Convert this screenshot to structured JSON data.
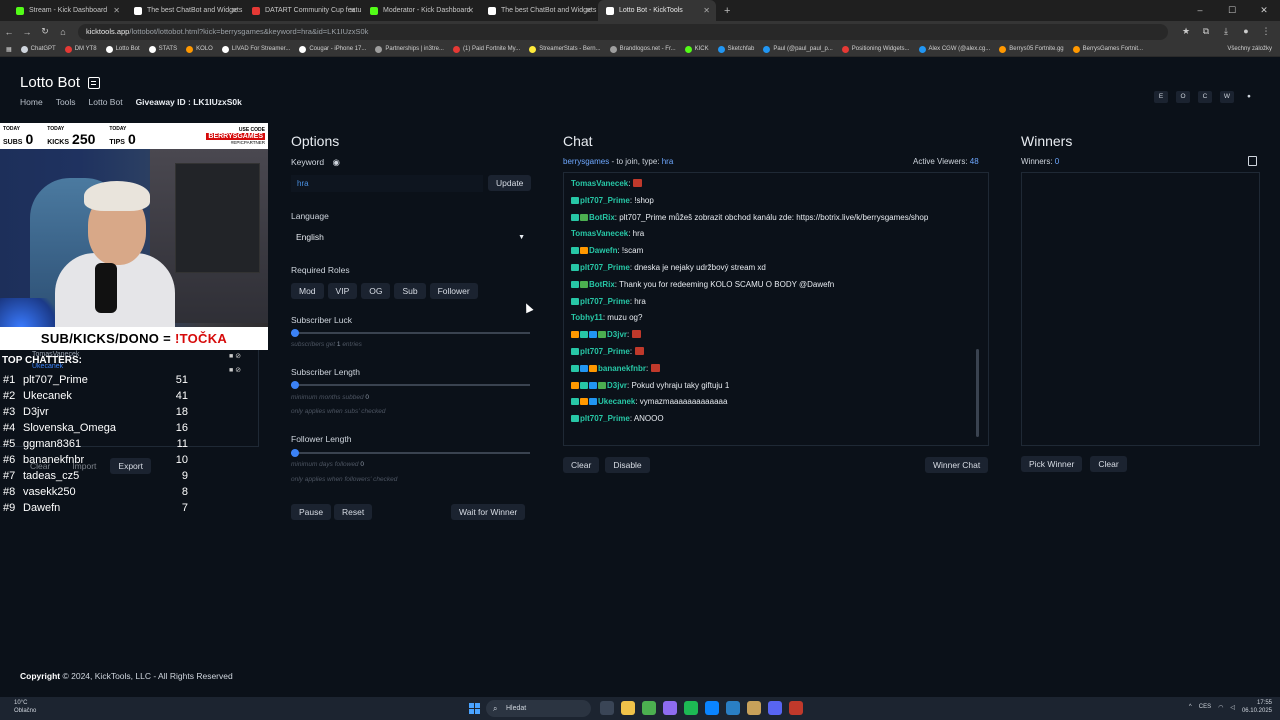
{
  "browser": {
    "tabs": [
      {
        "title": "Stream - Kick Dashboard",
        "color": "#53fc18",
        "active": false
      },
      {
        "title": "The best ChatBot and Widgets",
        "color": "#ffffff",
        "active": false
      },
      {
        "title": "DATART Community Cup featu",
        "color": "#e53935",
        "active": false
      },
      {
        "title": "Moderator - Kick Dashboard",
        "color": "#53fc18",
        "active": false
      },
      {
        "title": "The best ChatBot and Widgets",
        "color": "#ffffff",
        "active": false
      },
      {
        "title": "Lotto Bot - KickTools",
        "color": "#ffffff",
        "active": true
      }
    ],
    "url_host": "kicktools.app",
    "url_path": "/lottobot/lottobot.html?kick=berrysgames&keyword=hra&id=LK1IUzxS0k",
    "bookmarks": [
      {
        "label": "ChatGPT",
        "color": "#cfd5dd"
      },
      {
        "label": "DM YT8",
        "color": "#e53935"
      },
      {
        "label": "Lotto Bot",
        "color": "#ffffff"
      },
      {
        "label": "STATS",
        "color": "#ffffff"
      },
      {
        "label": "KOLO",
        "color": "#ff9800"
      },
      {
        "label": "LIVAD For Streamer...",
        "color": "#ffffff"
      },
      {
        "label": "Cougar - iPhone 17...",
        "color": "#ffffff"
      },
      {
        "label": "Partnerships | in3tre...",
        "color": "#9e9e9e"
      },
      {
        "label": "(1) Paid Fortnite My...",
        "color": "#e53935"
      },
      {
        "label": "StreamerStats - Bern...",
        "color": "#ffeb3b"
      },
      {
        "label": "Brandlogos.net - Fr...",
        "color": "#9e9e9e"
      },
      {
        "label": "KICK",
        "color": "#53fc18"
      },
      {
        "label": "Sketchfab",
        "color": "#2196f3"
      },
      {
        "label": "Paul (@paul_paul_p...",
        "color": "#2196f3"
      },
      {
        "label": "Positioning Widgets...",
        "color": "#e53935"
      },
      {
        "label": "Alex CGW (@alex.cg...",
        "color": "#2196f3"
      },
      {
        "label": "Berrys05 Fortnite.gg",
        "color": "#ff9800"
      },
      {
        "label": "BerrysGames Fortnit...",
        "color": "#ff9800"
      }
    ],
    "bookmarks_more": "Všechny záložky"
  },
  "page": {
    "title": "Lotto Bot",
    "breadcrumb": [
      "Home",
      "Tools",
      "Lotto Bot"
    ],
    "giveaway_id": "Giveaway ID : LK1IUzxS0k",
    "theme_buttons": [
      "E",
      "O",
      "C",
      "W"
    ]
  },
  "stream": {
    "stats": [
      {
        "today": "TODAY",
        "label": "SUBS",
        "value": "0"
      },
      {
        "today": "TODAY",
        "label": "KICKS",
        "value": "250"
      },
      {
        "today": "TODAY",
        "label": "TIPS",
        "value": "0"
      }
    ],
    "use_code": "USE CODE",
    "code": "BERRYSGAMES",
    "code_sub": "#EPICPARTNER",
    "banner_prefix": "SUB/KICKS/DONO = ",
    "banner_highlight": "!TOČKA",
    "top_chatters_title": "TOP CHATTERS:",
    "ghost_names": [
      "TomasVanecek",
      "Ukecanek"
    ],
    "chatters": [
      {
        "rank": "#1",
        "name": "plt707_Prime",
        "count": "51"
      },
      {
        "rank": "#2",
        "name": "Ukecanek",
        "count": "41"
      },
      {
        "rank": "#3",
        "name": "D3jvr",
        "count": "18"
      },
      {
        "rank": "#4",
        "name": "Slovenska_Omega",
        "count": "16"
      },
      {
        "rank": "#5",
        "name": "ggman8361",
        "count": "11"
      },
      {
        "rank": "#6",
        "name": "bananekfnbr",
        "count": "10"
      },
      {
        "rank": "#7",
        "name": "tadeas_cz5",
        "count": "9"
      },
      {
        "rank": "#8",
        "name": "vasekk250",
        "count": "8"
      },
      {
        "rank": "#9",
        "name": "Dawefn",
        "count": "7"
      }
    ],
    "buttons": {
      "clear": "Clear",
      "import": "Import",
      "export": "Export"
    }
  },
  "options": {
    "title": "Options",
    "keyword_label": "Keyword",
    "keyword_value": "hra",
    "update": "Update",
    "language_label": "Language",
    "language_value": "English",
    "roles_label": "Required Roles",
    "roles": [
      "Mod",
      "VIP",
      "OG",
      "Sub",
      "Follower"
    ],
    "sub_luck_label": "Subscriber Luck",
    "sub_luck_hint_pre": "subscribers get ",
    "sub_luck_value": "1",
    "sub_luck_hint_post": " entries",
    "sub_length_label": "Subscriber Length",
    "sub_length_hint": "minimum months subbed ",
    "sub_length_value": "0",
    "sub_length_note": "only applies when subs' checked",
    "follower_length_label": "Follower Length",
    "follower_length_hint": "minimum days followed ",
    "follower_length_value": "0",
    "follower_length_note": "only applies when followers' checked",
    "pause": "Pause",
    "reset": "Reset",
    "wait_for_winner": "Wait for Winner"
  },
  "chat": {
    "title": "Chat",
    "channel": "berrysgames",
    "join_text": " - to join, type: ",
    "join_keyword": "hra",
    "active_viewers_label": "Active Viewers: ",
    "active_viewers": "48",
    "messages": [
      {
        "user": "TomasVanecek",
        "text": ":",
        "badges": []
      },
      {
        "user": "plt707_Prime",
        "text": ": !shop",
        "badges": [
          "c"
        ]
      },
      {
        "user": "BotRix",
        "text": ": plt707_Prime můžeš zobrazit obchod kanálu zde: https://botrix.live/k/berrysgames/shop",
        "badges": [
          "c",
          "g"
        ]
      },
      {
        "user": "TomasVanecek",
        "text": ": hra",
        "badges": []
      },
      {
        "user": "Dawefn",
        "text": ": !scam",
        "badges": [
          "c",
          "o"
        ]
      },
      {
        "user": "plt707_Prime",
        "text": ": dneska je nejaky udržbový stream xd",
        "badges": [
          "c"
        ]
      },
      {
        "user": "BotRix",
        "text": ": Thank you for redeeming KOLO SCAMU O BODY @Dawefn",
        "badges": [
          "c",
          "g"
        ]
      },
      {
        "user": "plt707_Prime",
        "text": ": hra",
        "badges": [
          "c"
        ]
      },
      {
        "user": "Tobhy11",
        "text": ": muzu og?",
        "badges": []
      },
      {
        "user": "D3jvr",
        "text": ":",
        "badges": [
          "o",
          "c",
          "blue",
          "g"
        ]
      },
      {
        "user": "plt707_Prime",
        "text": ":",
        "badges": [
          "c"
        ]
      },
      {
        "user": "bananekfnbr",
        "text": ":",
        "badges": [
          "c",
          "blue",
          "o"
        ]
      },
      {
        "user": "D3jvr",
        "text": ": Pokud vyhraju taky giftuju 1",
        "badges": [
          "o",
          "c",
          "blue",
          "g"
        ]
      },
      {
        "user": "Ukecanek",
        "text": ": vymazmaaaaaaaaaaaaa",
        "badges": [
          "c",
          "o",
          "blue"
        ]
      },
      {
        "user": "plt707_Prime",
        "text": ": ANOOO",
        "badges": [
          "c"
        ]
      }
    ],
    "clear": "Clear",
    "disable": "Disable",
    "winner_chat": "Winner Chat"
  },
  "winners": {
    "title": "Winners",
    "count_label": "Winners: ",
    "count": "0",
    "pick_winner": "Pick Winner",
    "clear": "Clear"
  },
  "footer": {
    "copyright": "Copyright",
    "text": " © 2024, KickTools, LLC - All Rights Reserved"
  },
  "taskbar": {
    "temp": "10°C",
    "weather": "Oblačno",
    "search": "Hledat",
    "lang": "CES",
    "time": "17:55",
    "date": "06.10.2025"
  }
}
